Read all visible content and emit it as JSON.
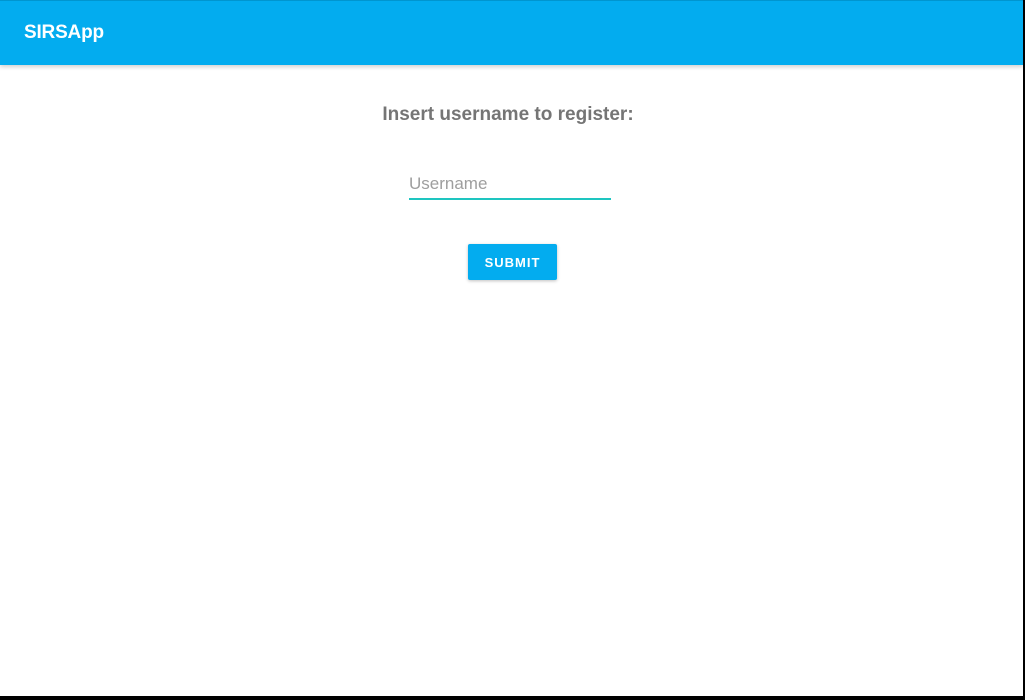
{
  "app": {
    "title": "SIRSApp",
    "accent_color": "#03acef"
  },
  "register": {
    "prompt": "Insert username to register:",
    "username_placeholder": "Username",
    "username_value": "",
    "submit_label": "SUBMIT"
  }
}
